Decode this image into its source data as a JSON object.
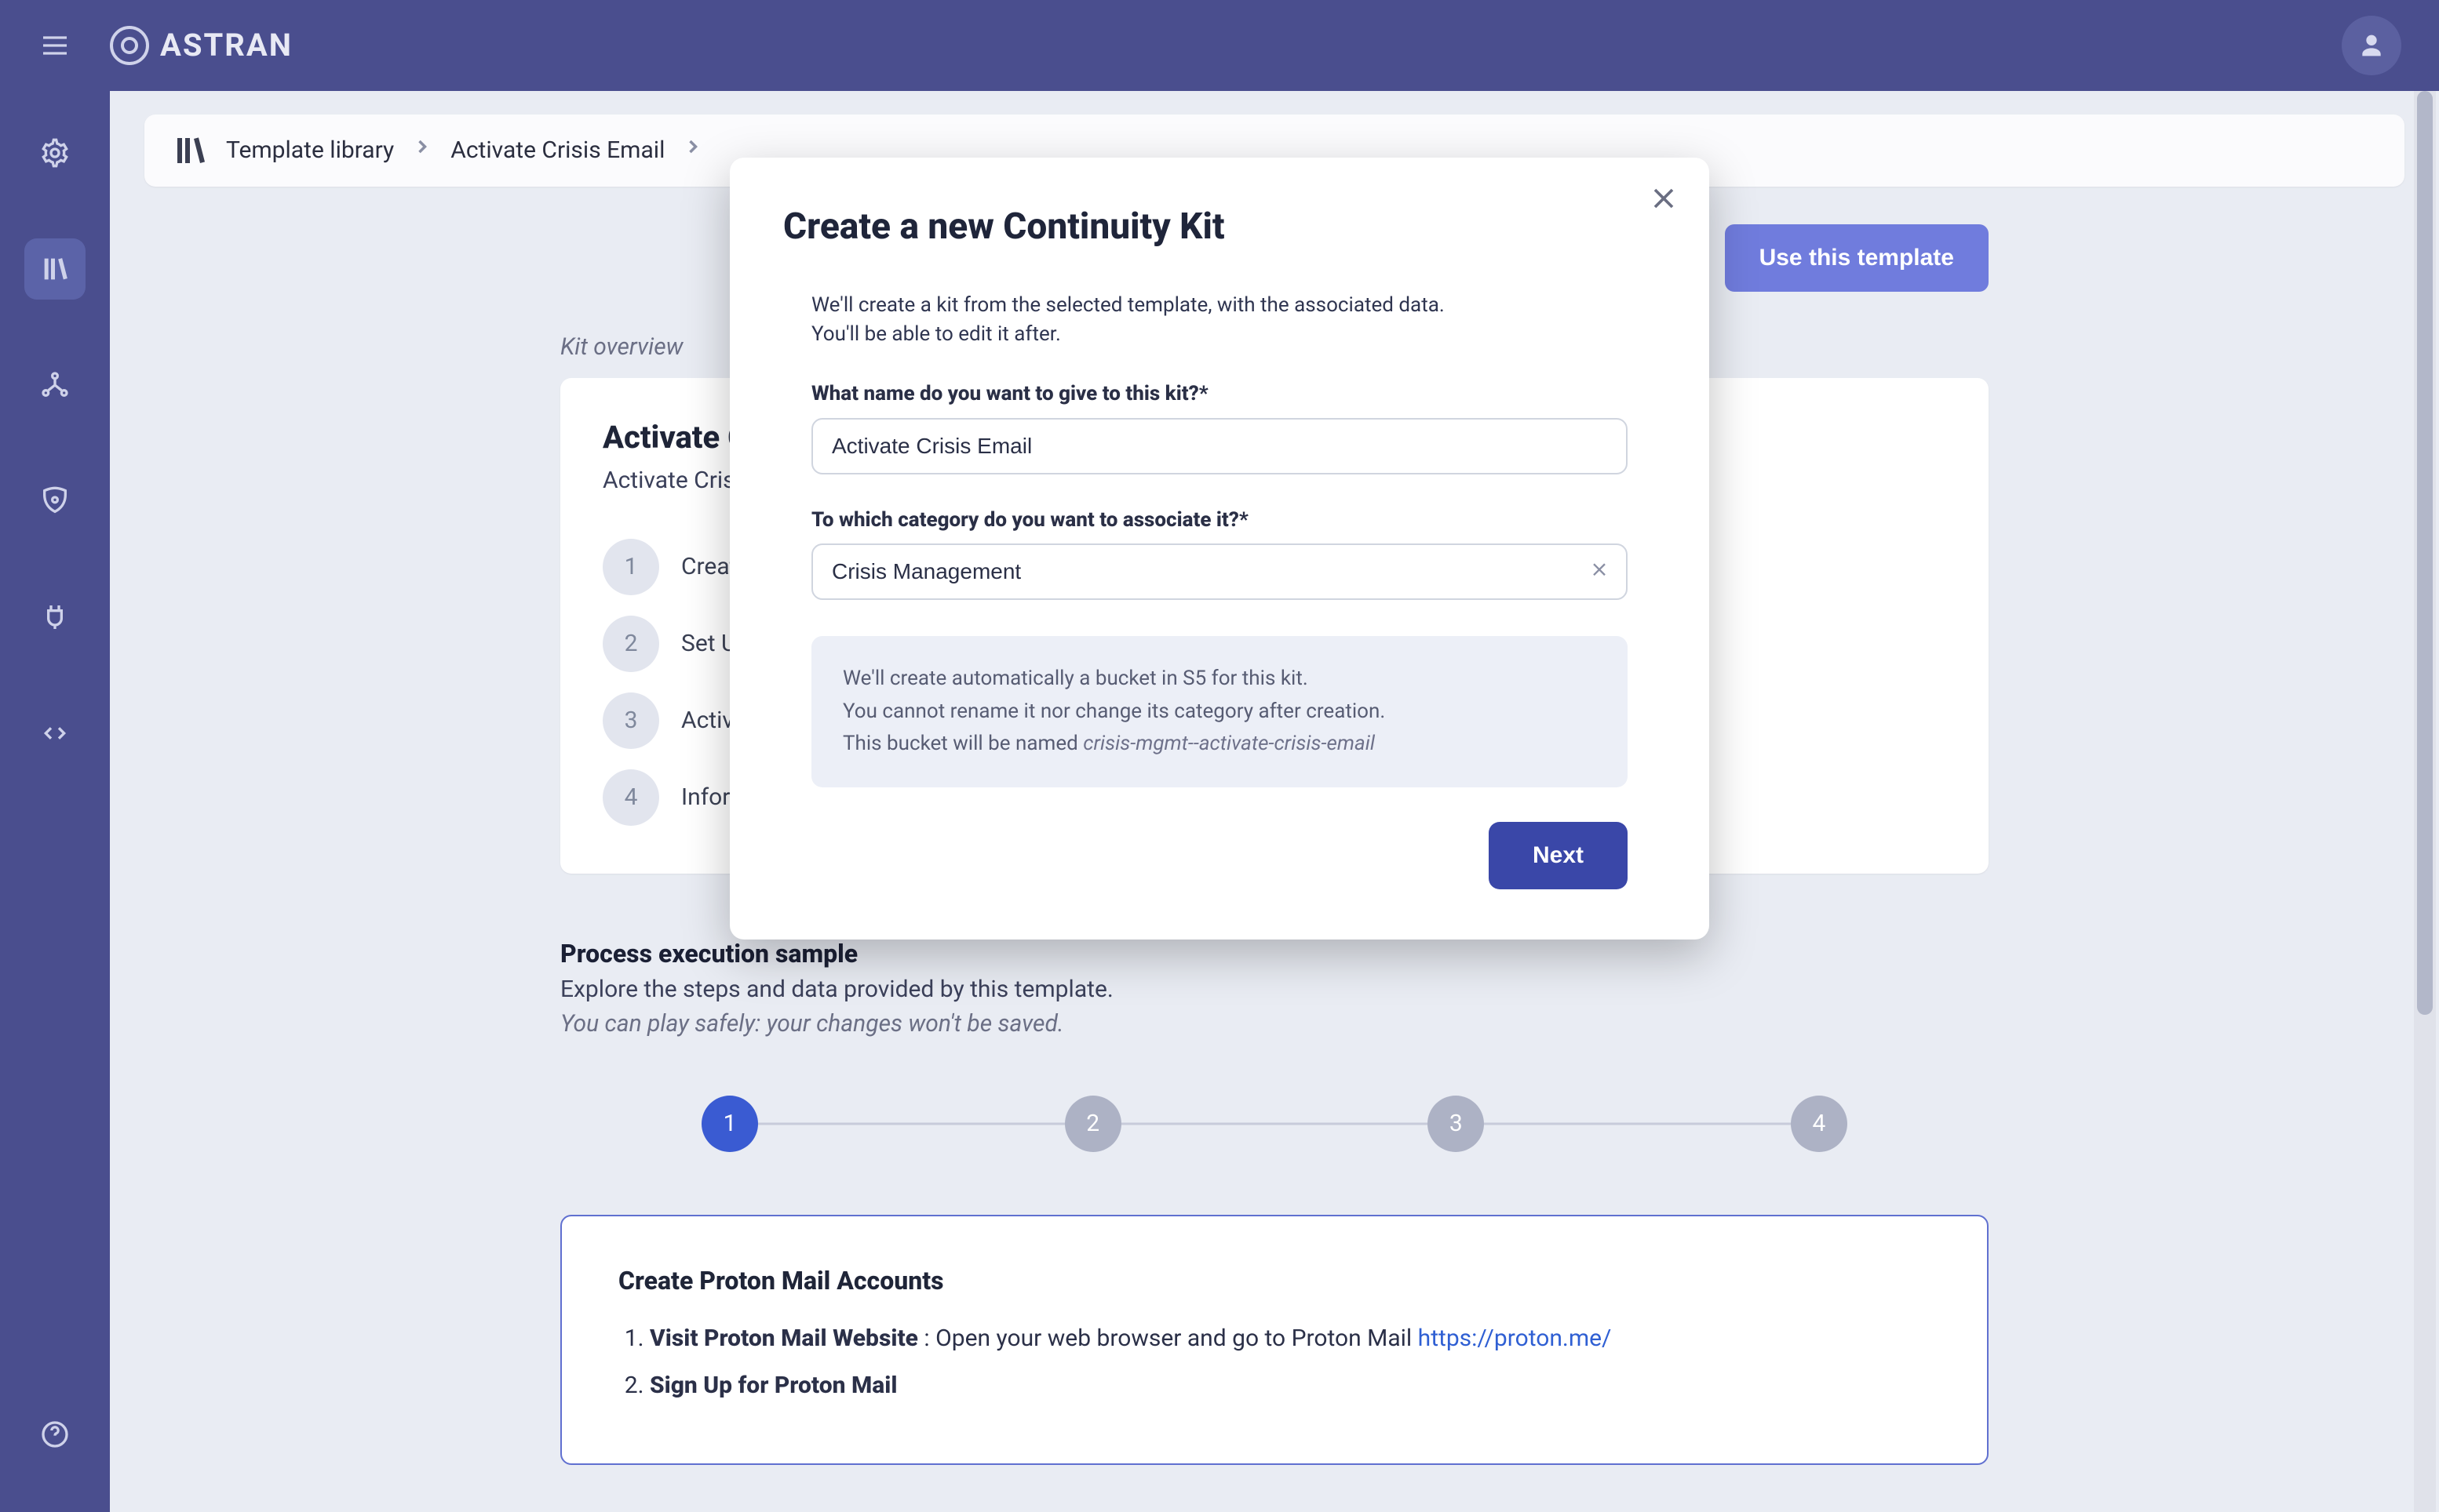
{
  "app": {
    "brand": "ASTRAN"
  },
  "sidebar": {
    "items": [
      {
        "name": "processes-icon"
      },
      {
        "name": "library-icon"
      },
      {
        "name": "teams-icon"
      },
      {
        "name": "security-icon"
      },
      {
        "name": "integrations-icon"
      },
      {
        "name": "api-icon"
      }
    ],
    "help": "help"
  },
  "breadcrumbs": {
    "root": "Template library",
    "leaf": "Activate Crisis Email"
  },
  "toolbar": {
    "use_template": "Use this template"
  },
  "overview": {
    "label": "Kit overview",
    "title": "Activate Crisis Email",
    "subtitle": "Activate Crisis Communicate Mail",
    "steps": [
      {
        "n": "1",
        "label": "Create Proton Mail Accounts"
      },
      {
        "n": "2",
        "label": "Set Up Custom Domain or Aliases"
      },
      {
        "n": "3",
        "label": "Activate MFA"
      },
      {
        "n": "4",
        "label": "Inform Users About the Fallback Email"
      }
    ]
  },
  "process_section": {
    "title": "Process execution sample",
    "sub": "Explore the steps and data provided by this template.",
    "note": "You can play safely: your changes won't be saved."
  },
  "stepper": {
    "steps": [
      "1",
      "2",
      "3",
      "4"
    ],
    "current_index": 0
  },
  "sample": {
    "title": "Create Proton Mail Accounts",
    "item1_bold": "Visit Proton Mail Website",
    "item1_rest": " : Open your web browser and go to Proton Mail ",
    "item1_link_text": "https://proton.me/",
    "item2_bold": "Sign Up for Proton Mail"
  },
  "modal": {
    "title": "Create a new Continuity Kit",
    "intro1": "We'll create a kit from the selected template, with the associated data.",
    "intro2": "You'll be able to edit it after.",
    "name_label": "What name do you want to give to this kit?*",
    "name_value": "Activate Crisis Email",
    "cat_label": "To which category do you want to associate it?*",
    "cat_value": "Crisis Management",
    "info_l1": "We'll create automatically a bucket in S5 for this kit.",
    "info_l2": "You cannot rename it nor change its category after creation.",
    "info_l3_pre": "This bucket will be named ",
    "info_l3_code": "crisis-mgmt--activate-crisis-email",
    "next": "Next"
  }
}
